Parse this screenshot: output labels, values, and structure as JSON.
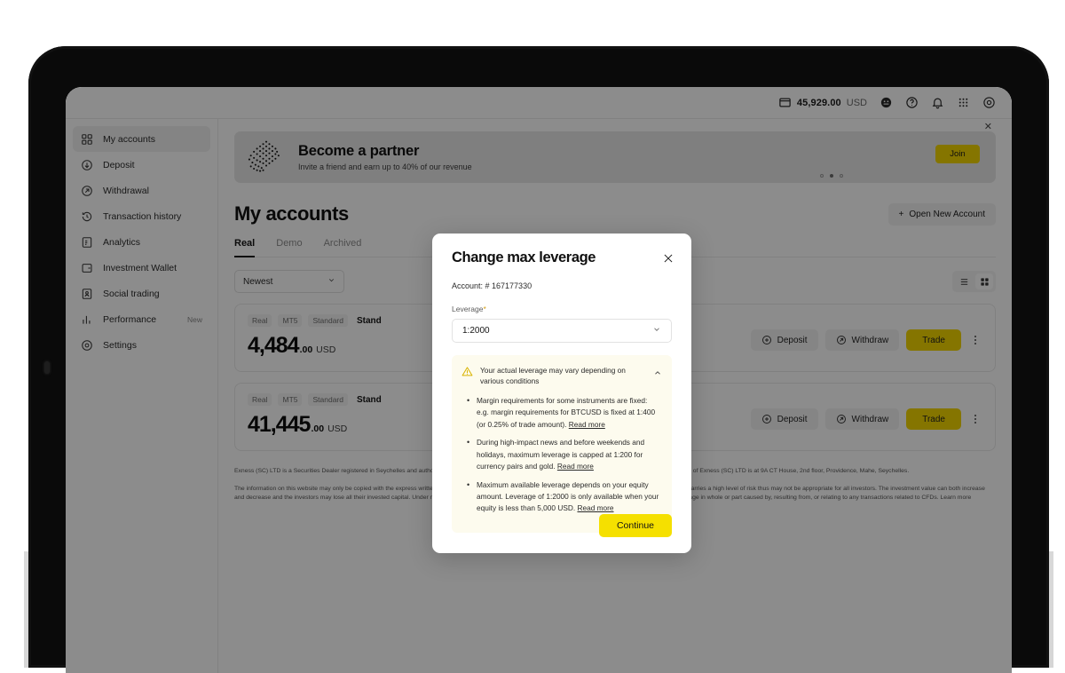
{
  "topbar": {
    "balance_amount": "45,929.00",
    "balance_currency": "USD",
    "icons": [
      "wallet-icon",
      "support-chat-icon",
      "help-circle-icon",
      "notifications-bell-icon",
      "apps-grid-icon",
      "settings-gear-icon"
    ]
  },
  "sidebar": {
    "items": [
      {
        "label": "My accounts",
        "icon": "grid-squares-icon",
        "active": true,
        "badge": ""
      },
      {
        "label": "Deposit",
        "icon": "arrow-down-circle-icon",
        "active": false,
        "badge": ""
      },
      {
        "label": "Withdrawal",
        "icon": "arrow-up-right-circle-icon",
        "active": false,
        "badge": ""
      },
      {
        "label": "Transaction history",
        "icon": "clock-history-icon",
        "active": false,
        "badge": ""
      },
      {
        "label": "Analytics",
        "icon": "document-chart-icon",
        "active": false,
        "badge": ""
      },
      {
        "label": "Investment Wallet",
        "icon": "wallet-card-icon",
        "active": false,
        "badge": ""
      },
      {
        "label": "Social trading",
        "icon": "social-people-icon",
        "active": false,
        "badge": ""
      },
      {
        "label": "Performance",
        "icon": "bar-chart-icon",
        "active": false,
        "badge": "New"
      },
      {
        "label": "Settings",
        "icon": "gear-circle-icon",
        "active": false,
        "badge": ""
      }
    ]
  },
  "banner": {
    "title": "Become a partner",
    "subtitle": "Invite a friend and earn up to 40% of our revenue",
    "cta_label": "Join",
    "close_icon": "close-icon",
    "dots_total": 3,
    "dots_active_index": 1
  },
  "page": {
    "title": "My accounts",
    "open_new_account_label": "Open New Account",
    "tabs": [
      {
        "label": "Real",
        "active": true
      },
      {
        "label": "Demo",
        "active": false
      },
      {
        "label": "Archived",
        "active": false
      }
    ],
    "sort_value": "Newest",
    "view_modes": [
      "list-view-icon",
      "grid-view-icon"
    ],
    "view_active": "grid-view-icon"
  },
  "accounts": [
    {
      "chips": [
        "Real",
        "MT5",
        "Standard"
      ],
      "name": "Stand",
      "balance_int": "4,484",
      "balance_dec": ".00",
      "currency": "USD",
      "actions": [
        "Deposit",
        "Withdraw",
        "Trade"
      ]
    },
    {
      "chips": [
        "Real",
        "MT5",
        "Standard"
      ],
      "name": "Stand",
      "balance_int": "41,445",
      "balance_dec": ".00",
      "currency": "USD",
      "actions": [
        "Deposit",
        "Withdraw",
        "Trade"
      ]
    }
  ],
  "footer": {
    "paragraph1": "Exness (SC) LTD is a Securities Dealer registered in Seychelles and authorised by the Financial Services Authority (FSA) with licence number SD025. The registered office of Exness (SC) LTD is at 9A CT House, 2nd floor, Providence, Mahe, Seychelles.",
    "paragraph2": "The information on this website may only be copied with the express written permission of Exness. General Risk Warning: CFDs are leveraged products. Trading in CFDs carries a high level of risk thus may not be appropriate for all investors. The investment value can both increase and decrease and the investors may lose all their invested capital. Under no circumstances shall the Company have any liability to any person or entity for any loss or damage in whole or part caused by, resulting from, or relating to any transactions related to CFDs. Learn more"
  },
  "modal": {
    "title": "Change max leverage",
    "close_icon": "close-icon",
    "account_line": "Account: # 167177330",
    "leverage_label": "Leverage",
    "required_mark": "*",
    "leverage_value": "1:2000",
    "chevron_icon": "chevron-down-icon",
    "notice": {
      "warn_icon": "warning-triangle-icon",
      "collapse_icon": "chevron-up-icon",
      "title": "Your actual leverage may vary depending on various conditions",
      "bullets": [
        {
          "text": "Margin requirements for some instruments are fixed: e.g. margin requirements for BTCUSD is fixed at 1:400 (or 0.25% of trade amount).",
          "link": "Read more"
        },
        {
          "text": "During high-impact news and before weekends and holidays, maximum leverage is capped at 1:200 for currency pairs and gold.",
          "link": "Read more"
        },
        {
          "text": "Maximum available leverage depends on your equity amount. Leverage of 1:2000 is only available when your equity is less than 5,000 USD.",
          "link": "Read more"
        }
      ]
    },
    "continue_label": "Continue"
  },
  "colors": {
    "brand_yellow": "#f5e000",
    "banner_yellow": "#f2d600",
    "notice_bg": "#fdfbee",
    "warn": "#d9b300"
  }
}
